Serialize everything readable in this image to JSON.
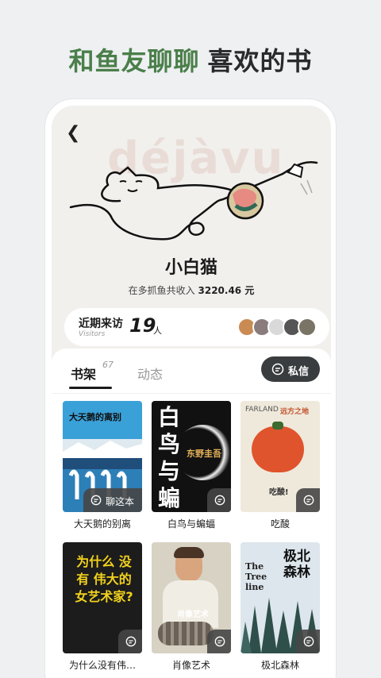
{
  "headline": {
    "part1": "和鱼友聊聊",
    "part2": "喜欢的书"
  },
  "profile": {
    "background_text": "déjàvu",
    "username": "小白猫",
    "income_prefix": "在多抓鱼共收入",
    "income_amount": "3220.46 元"
  },
  "visitors": {
    "title": "近期来访",
    "subtitle": "Visitors",
    "count": "19",
    "unit": "人"
  },
  "shelf": {
    "tab_shelf": "书架",
    "tab_shelf_count": "67",
    "tab_moments": "动态",
    "message_button": "私信",
    "chat_label": "聊这本",
    "books": [
      {
        "title": "大天鹅的别离",
        "cover_title": "大天鹅的离别"
      },
      {
        "title": "白鸟与蝙蝠",
        "cover_title": "白 鸟 与 蝙 蝠",
        "cover_author": "东野圭吾"
      },
      {
        "title": "吃酸",
        "cover_brand": "FARLAND",
        "cover_series": "远方之地",
        "cover_title": "吃酸!",
        "cover_subtitle": "吃酸!"
      },
      {
        "title": "为什么没有伟…",
        "cover_title": "为什么 没有 伟大的 女艺术家?"
      },
      {
        "title": "肖像艺术",
        "cover_title": "肖像艺术"
      },
      {
        "title": "极北森林",
        "cover_title": "极北 森林",
        "cover_en": "The Tree line"
      }
    ]
  },
  "colors": {
    "accent_green": "#4b7f4a",
    "button_dark": "#3a3d3f"
  }
}
